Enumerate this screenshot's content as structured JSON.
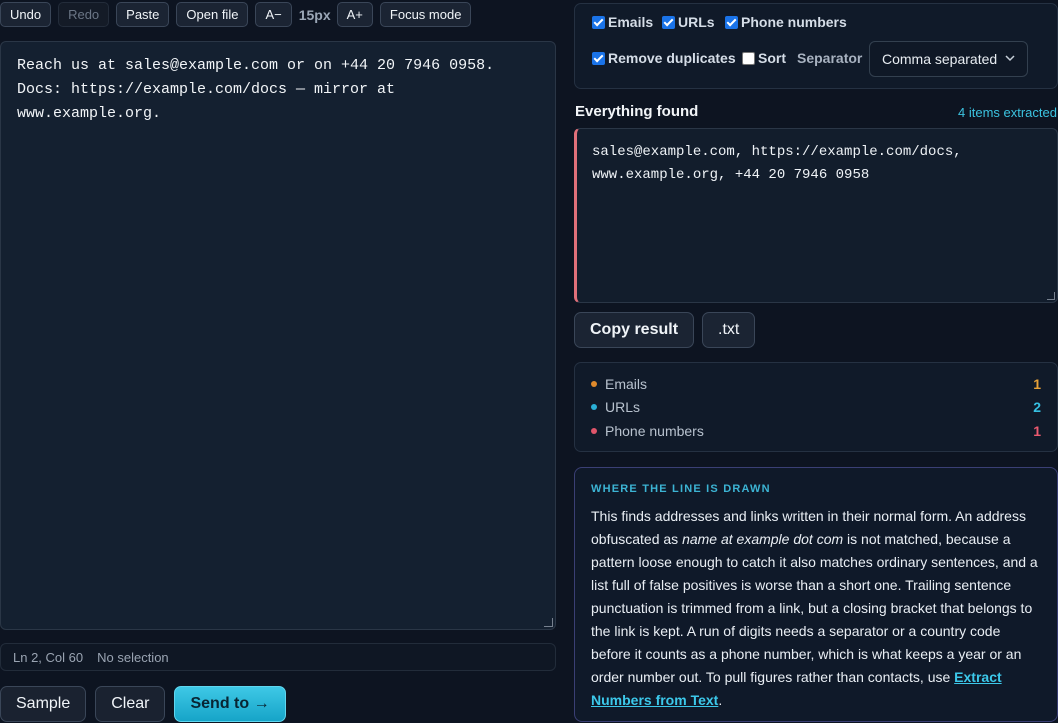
{
  "toolbar": {
    "undo": "Undo",
    "redo": "Redo",
    "paste": "Paste",
    "open_file": "Open file",
    "font_smaller": "A−",
    "font_size": "15px",
    "font_larger": "A+",
    "focus_mode": "Focus mode"
  },
  "editor": {
    "lines": [
      "Reach us at sales@example.com or on +44 20 7946 0958.",
      "Docs: https://example.com/docs — mirror at",
      "www.example.org."
    ]
  },
  "status": {
    "position": "Ln 2, Col 60",
    "selection": "No selection"
  },
  "bottom": {
    "sample": "Sample",
    "clear": "Clear",
    "send_to": "Send to →"
  },
  "options": {
    "emails": {
      "label": "Emails",
      "checked": true
    },
    "urls": {
      "label": "URLs",
      "checked": true
    },
    "phones": {
      "label": "Phone numbers",
      "checked": true
    },
    "remove_duplicates": {
      "label": "Remove duplicates",
      "checked": true
    },
    "sort": {
      "label": "Sort",
      "checked": false
    },
    "separator_label": "Separator",
    "separator_value": "Comma separated"
  },
  "found": {
    "title": "Everything found",
    "count": "4 items extracted",
    "lines": [
      "sales@example.com, https://example.com/docs,",
      "www.example.org, +44 20 7946 0958"
    ]
  },
  "actions": {
    "copy": "Copy result",
    "txt": ".txt"
  },
  "counts": [
    {
      "label": "Emails",
      "value": "1",
      "color": "#e08a2c"
    },
    {
      "label": "URLs",
      "value": "2",
      "color": "#2ab0d6"
    },
    {
      "label": "Phone numbers",
      "value": "1",
      "color": "#e0556a"
    }
  ],
  "note": {
    "heading": "WHERE THE LINE IS DRAWN",
    "text_1": "This finds addresses and links written in their normal form. An address obfuscated as ",
    "italic": "name at example dot com",
    "text_2": " is not matched, because a pattern loose enough to catch it also matches ordinary sentences, and a list full of false positives is worse than a short one. Trailing sentence punctuation is trimmed from a link, but a closing bracket that belongs to the link is kept. A run of digits needs a separator or a country code before it counts as a phone number, which is what keeps a year or an order number out. To pull figures rather than contacts, use ",
    "link": "Extract Numbers from Text",
    "text_3": "."
  }
}
